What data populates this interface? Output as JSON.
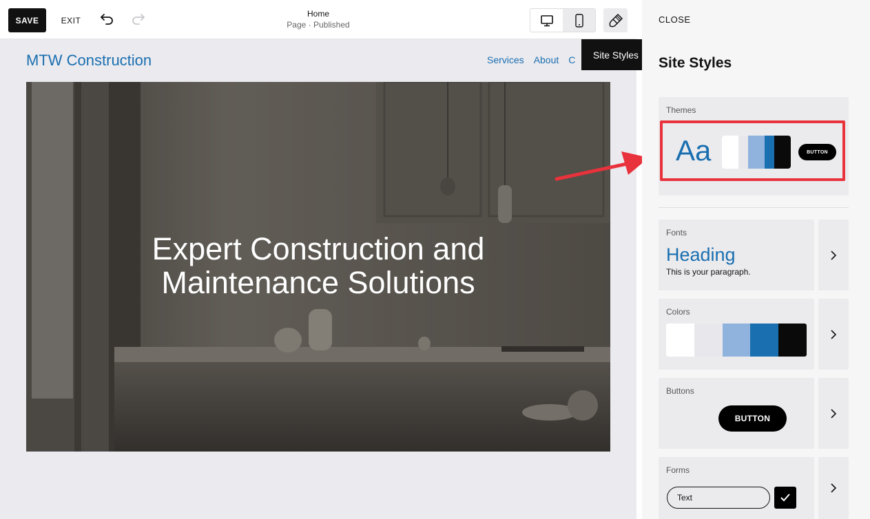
{
  "toolbar": {
    "save_label": "SAVE",
    "exit_label": "EXIT",
    "page_title": "Home",
    "page_status": "Page · Published",
    "undo_icon": "undo-icon",
    "redo_icon": "redo-icon",
    "desktop_icon": "desktop-icon",
    "mobile_icon": "mobile-icon",
    "brush_icon": "paintbrush-icon"
  },
  "canvas": {
    "site_title": "MTW Construction",
    "nav": [
      "Services",
      "About",
      "C"
    ],
    "hero_heading_line1": "Expert Construction and",
    "hero_heading_line2": "Maintenance Solutions"
  },
  "tooltip": "Site Styles",
  "panel": {
    "close_label": "CLOSE",
    "title": "Site Styles",
    "themes": {
      "label": "Themes",
      "sample_text": "Aa",
      "button_label": "BUTTON",
      "swatches": [
        "#ffffff",
        "#e8e8ec",
        "#8fb3dd",
        "#1a6fb0",
        "#0a0a0a"
      ]
    },
    "fonts": {
      "label": "Fonts",
      "heading": "Heading",
      "paragraph": "This is your paragraph."
    },
    "colors": {
      "label": "Colors",
      "swatches": [
        "#ffffff",
        "#e8e8ec",
        "#8fb3dd",
        "#1a6fb0",
        "#0a0a0a"
      ]
    },
    "buttons": {
      "label": "Buttons",
      "button_label": "BUTTON"
    },
    "forms": {
      "label": "Forms",
      "input_text": "Text"
    }
  },
  "colors": {
    "accent": "#1a6fb0",
    "highlight": "#e8323c"
  }
}
